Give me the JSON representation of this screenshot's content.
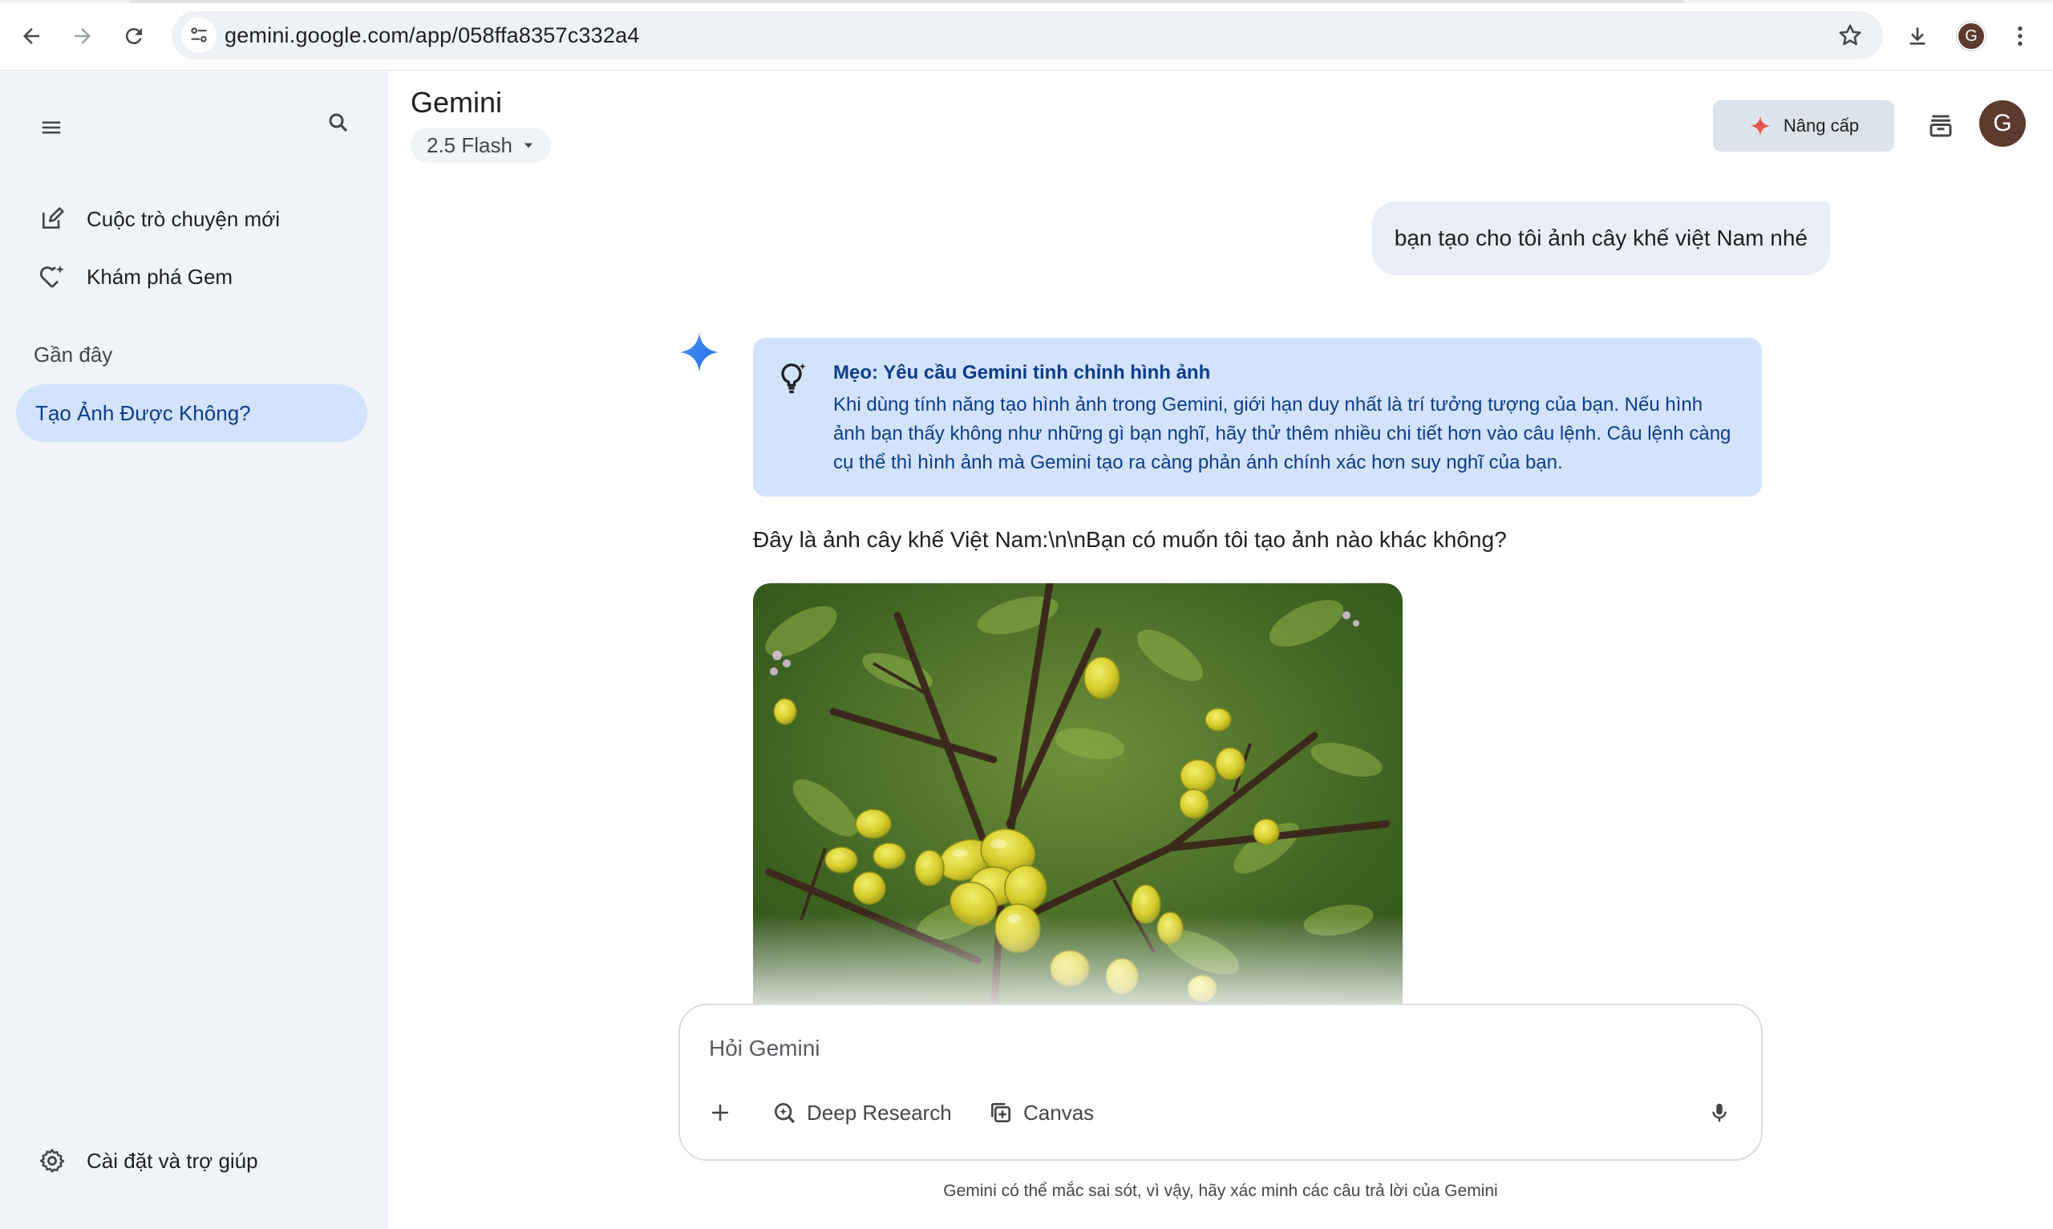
{
  "browser": {
    "url": "gemini.google.com/app/058ffa8357c332a4",
    "profile_initial": "G",
    "icons": [
      "back-icon",
      "forward-icon",
      "reload-icon",
      "site-info-icon",
      "bookmark-star-icon",
      "download-icon",
      "more-vert-icon"
    ]
  },
  "sidebar": {
    "new_chat_label": "Cuộc trò chuyện mới",
    "explore_gems_label": "Khám phá Gem",
    "recent_heading": "Gần đây",
    "recent_items": [
      "Tạo Ảnh Được Không?"
    ],
    "settings_label": "Cài đặt và trợ giúp"
  },
  "header": {
    "title": "Gemini",
    "model": "2.5 Flash",
    "upgrade_label": "Nâng cấp",
    "avatar_initial": "G"
  },
  "chat": {
    "user_message": "bạn tạo cho tôi ảnh cây khế việt Nam nhé",
    "tip_title": "Mẹo: Yêu cầu Gemini tinh chỉnh hình ảnh",
    "tip_body": "Khi dùng tính năng tạo hình ảnh trong Gemini, giới hạn duy nhất là trí tưởng tượng của bạn. Nếu hình ảnh bạn thấy không như những gì bạn nghĩ, hãy thử thêm nhiều chi tiết hơn vào câu lệnh. Câu lệnh càng cụ thể thì hình ảnh mà Gemini tạo ra càng phản ánh chính xác hơn suy nghĩ của bạn.",
    "response_text": "Đây là ảnh cây khế Việt Nam:\\n\\nBạn có muốn tôi tạo ảnh nào khác không?"
  },
  "composer": {
    "placeholder": "Hỏi Gemini",
    "deep_research_label": "Deep Research",
    "canvas_label": "Canvas"
  },
  "footer": {
    "disclaimer": "Gemini có thể mắc sai sót, vì vậy, hãy xác minh các câu trả lời của Gemini"
  },
  "colors": {
    "sidebar_bg": "#f0f4f9",
    "recent_active_bg": "#d3e3fd",
    "tip_bg": "#d3e3fd",
    "tip_text": "#0b3c8c",
    "user_bubble_bg": "#e9eef6",
    "gemini_blue": "#4285f4",
    "avatar_bg": "#5c3a2e"
  }
}
